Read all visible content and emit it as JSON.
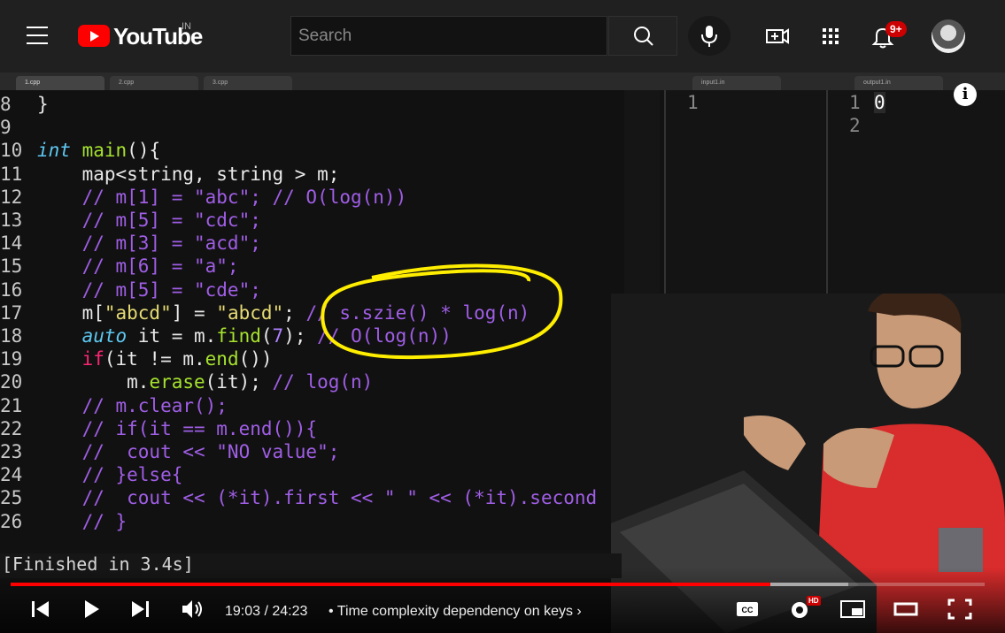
{
  "header": {
    "logo_text": "YouTube",
    "country_code": "IN",
    "search_placeholder": "Search",
    "notification_count": "9+"
  },
  "editor": {
    "tabs": [
      "1.cpp",
      "2.cpp",
      "3.cpp"
    ],
    "input_tab": "input1.in",
    "output_tab": "output1.in",
    "input_lines": [
      "1"
    ],
    "output_line_numbers": [
      "1",
      "2"
    ],
    "output_value": "0",
    "code_lines": [
      {
        "n": "8",
        "segs": [
          [
            "p",
            "}"
          ]
        ]
      },
      {
        "n": "9",
        "segs": []
      },
      {
        "n": "10",
        "segs": [
          [
            "kw",
            "int"
          ],
          [
            "p",
            " "
          ],
          [
            "fn",
            "main"
          ],
          [
            "p",
            "(){"
          ]
        ]
      },
      {
        "n": "11",
        "segs": [
          [
            "p",
            "    map<string, string > m;"
          ]
        ]
      },
      {
        "n": "12",
        "segs": [
          [
            "cm",
            "    // m[1] = \"abc\"; // O(log(n))"
          ]
        ]
      },
      {
        "n": "13",
        "segs": [
          [
            "cm",
            "    // m[5] = \"cdc\";"
          ]
        ]
      },
      {
        "n": "14",
        "segs": [
          [
            "cm",
            "    // m[3] = \"acd\";"
          ]
        ]
      },
      {
        "n": "15",
        "segs": [
          [
            "cm",
            "    // m[6] = \"a\";"
          ]
        ]
      },
      {
        "n": "16",
        "segs": [
          [
            "cm",
            "    // m[5] = \"cde\";"
          ]
        ]
      },
      {
        "n": "17",
        "segs": [
          [
            "p",
            "    m["
          ],
          [
            "str",
            "\"abcd\""
          ],
          [
            "p",
            "] = "
          ],
          [
            "str",
            "\"abcd\""
          ],
          [
            "p",
            "; "
          ],
          [
            "cm",
            "// s.szie() * log(n)"
          ]
        ]
      },
      {
        "n": "18",
        "segs": [
          [
            "kw",
            "    auto"
          ],
          [
            "p",
            " it = m."
          ],
          [
            "fn",
            "find"
          ],
          [
            "p",
            "("
          ],
          [
            "num",
            "7"
          ],
          [
            "p",
            "); "
          ],
          [
            "cm",
            "// O(log(n))"
          ]
        ]
      },
      {
        "n": "19",
        "segs": [
          [
            "pink",
            "    if"
          ],
          [
            "p",
            "(it != m."
          ],
          [
            "fn",
            "end"
          ],
          [
            "p",
            "())"
          ]
        ]
      },
      {
        "n": "20",
        "segs": [
          [
            "p",
            "        m."
          ],
          [
            "fn",
            "erase"
          ],
          [
            "p",
            "(it); "
          ],
          [
            "cm",
            "// log(n)"
          ]
        ]
      },
      {
        "n": "21",
        "segs": [
          [
            "cm",
            "    // m.clear();"
          ]
        ]
      },
      {
        "n": "22",
        "segs": [
          [
            "cm",
            "    // if(it == m.end()){"
          ]
        ]
      },
      {
        "n": "23",
        "segs": [
          [
            "cm",
            "    //  cout << \"NO value\";"
          ]
        ]
      },
      {
        "n": "24",
        "segs": [
          [
            "cm",
            "    // }else{"
          ]
        ]
      },
      {
        "n": "25",
        "segs": [
          [
            "cm",
            "    //  cout << (*it).first << \" \" << (*it).second"
          ]
        ]
      },
      {
        "n": "26",
        "segs": [
          [
            "cm",
            "    // }"
          ]
        ]
      }
    ],
    "build_status": "[Finished in 3.4s]"
  },
  "player": {
    "current_time": "19:03",
    "duration": "24:23",
    "time_display": "19:03 / 24:23",
    "chapter_bullet": "•",
    "chapter_title": "Time complexity dependency on keys",
    "progress_fraction": 0.78,
    "quality_badge": "HD"
  },
  "icons": {
    "menu": "hamburger-icon",
    "search": "search-icon",
    "mic": "microphone-icon",
    "create": "create-video-icon",
    "apps": "apps-grid-icon",
    "notifications": "bell-icon",
    "info": "info-icon"
  },
  "colors": {
    "brand_red": "#ff0000",
    "badge_red": "#cc0000",
    "annotation_yellow": "#ffee00"
  }
}
